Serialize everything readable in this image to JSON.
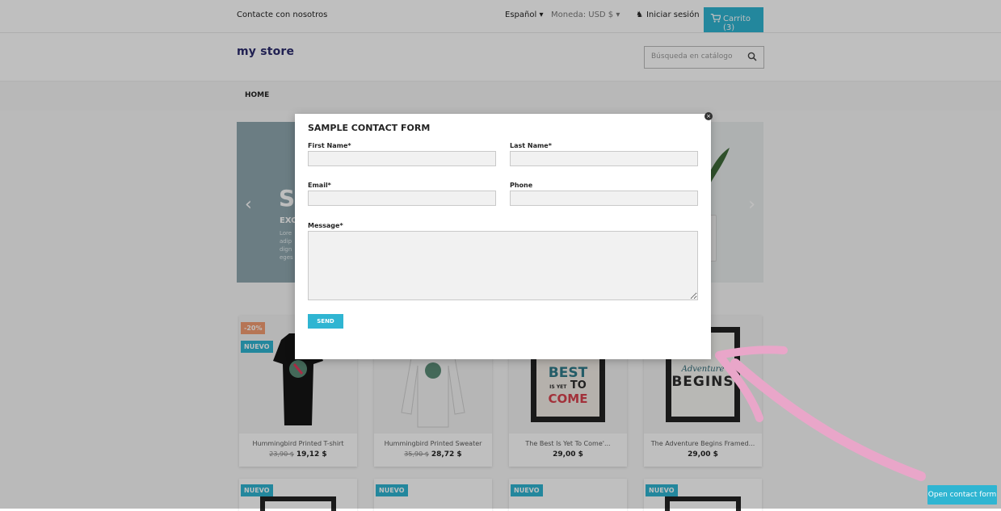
{
  "topbar": {
    "contact": "Contacte con nosotros",
    "language": "Español",
    "currency": "Moneda: USD $",
    "login": "Iniciar sesión",
    "cart": "Carrito (3)"
  },
  "header": {
    "logo": "my store",
    "search_placeholder": "Búsqueda en catálogo"
  },
  "nav": {
    "home": "HOME"
  },
  "slider": {
    "headline": "SA",
    "subheadline": "EXC",
    "body": "Lore\nadip\ndign\neges"
  },
  "products": [
    {
      "name": "Hummingbird Printed T-shirt",
      "old_price": "23,90 $",
      "price": "19,12 $",
      "badges": [
        "-20%",
        "NUEVO"
      ]
    },
    {
      "name": "Hummingbird Printed Sweater",
      "old_price": "35,90 $",
      "price": "28,72 $",
      "badges": []
    },
    {
      "name": "The Best Is Yet To Come'...",
      "old_price": "",
      "price": "29,00 $",
      "badges": []
    },
    {
      "name": "The Adventure Begins Framed...",
      "old_price": "",
      "price": "29,00 $",
      "badges": []
    }
  ],
  "products_row2_badges": [
    "NUEVO",
    "NUEVO",
    "NUEVO",
    "NUEVO"
  ],
  "poster_best": {
    "line1": "BEST",
    "line2": "IS YET",
    "line3": "TO",
    "line4": "COME"
  },
  "poster_adventure": {
    "line1": "Adventure",
    "line2": "BEGINS"
  },
  "modal": {
    "title": "SAMPLE CONTACT FORM",
    "first_name_label": "First Name*",
    "last_name_label": "Last Name*",
    "email_label": "Email*",
    "phone_label": "Phone",
    "message_label": "Message*",
    "send_label": "SEND",
    "close_icon": "×"
  },
  "open_button": "Open contact form",
  "colors": {
    "accent": "#2fb5d2",
    "discount": "#f39d72",
    "annotation_arrow": "#e9a6c9"
  }
}
